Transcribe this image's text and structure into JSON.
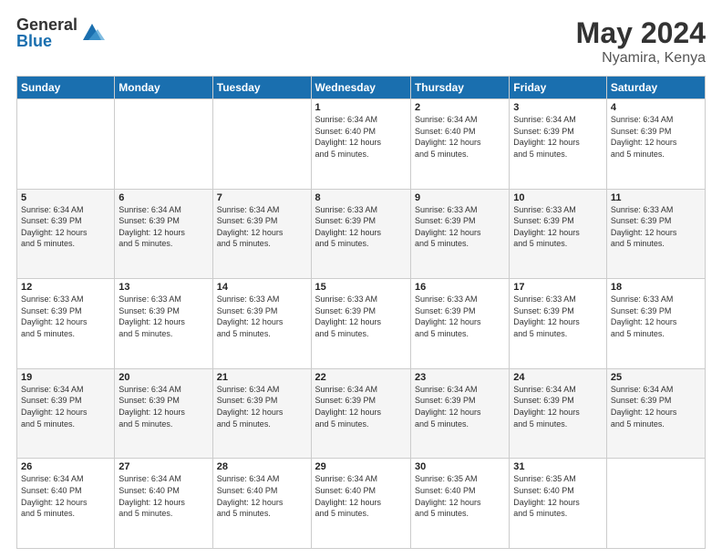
{
  "header": {
    "logo_general": "General",
    "logo_blue": "Blue",
    "month": "May 2024",
    "location": "Nyamira, Kenya"
  },
  "weekdays": [
    "Sunday",
    "Monday",
    "Tuesday",
    "Wednesday",
    "Thursday",
    "Friday",
    "Saturday"
  ],
  "rows": [
    [
      {
        "day": "",
        "info": ""
      },
      {
        "day": "",
        "info": ""
      },
      {
        "day": "",
        "info": ""
      },
      {
        "day": "1",
        "info": "Sunrise: 6:34 AM\nSunset: 6:40 PM\nDaylight: 12 hours\nand 5 minutes."
      },
      {
        "day": "2",
        "info": "Sunrise: 6:34 AM\nSunset: 6:40 PM\nDaylight: 12 hours\nand 5 minutes."
      },
      {
        "day": "3",
        "info": "Sunrise: 6:34 AM\nSunset: 6:39 PM\nDaylight: 12 hours\nand 5 minutes."
      },
      {
        "day": "4",
        "info": "Sunrise: 6:34 AM\nSunset: 6:39 PM\nDaylight: 12 hours\nand 5 minutes."
      }
    ],
    [
      {
        "day": "5",
        "info": "Sunrise: 6:34 AM\nSunset: 6:39 PM\nDaylight: 12 hours\nand 5 minutes."
      },
      {
        "day": "6",
        "info": "Sunrise: 6:34 AM\nSunset: 6:39 PM\nDaylight: 12 hours\nand 5 minutes."
      },
      {
        "day": "7",
        "info": "Sunrise: 6:34 AM\nSunset: 6:39 PM\nDaylight: 12 hours\nand 5 minutes."
      },
      {
        "day": "8",
        "info": "Sunrise: 6:33 AM\nSunset: 6:39 PM\nDaylight: 12 hours\nand 5 minutes."
      },
      {
        "day": "9",
        "info": "Sunrise: 6:33 AM\nSunset: 6:39 PM\nDaylight: 12 hours\nand 5 minutes."
      },
      {
        "day": "10",
        "info": "Sunrise: 6:33 AM\nSunset: 6:39 PM\nDaylight: 12 hours\nand 5 minutes."
      },
      {
        "day": "11",
        "info": "Sunrise: 6:33 AM\nSunset: 6:39 PM\nDaylight: 12 hours\nand 5 minutes."
      }
    ],
    [
      {
        "day": "12",
        "info": "Sunrise: 6:33 AM\nSunset: 6:39 PM\nDaylight: 12 hours\nand 5 minutes."
      },
      {
        "day": "13",
        "info": "Sunrise: 6:33 AM\nSunset: 6:39 PM\nDaylight: 12 hours\nand 5 minutes."
      },
      {
        "day": "14",
        "info": "Sunrise: 6:33 AM\nSunset: 6:39 PM\nDaylight: 12 hours\nand 5 minutes."
      },
      {
        "day": "15",
        "info": "Sunrise: 6:33 AM\nSunset: 6:39 PM\nDaylight: 12 hours\nand 5 minutes."
      },
      {
        "day": "16",
        "info": "Sunrise: 6:33 AM\nSunset: 6:39 PM\nDaylight: 12 hours\nand 5 minutes."
      },
      {
        "day": "17",
        "info": "Sunrise: 6:33 AM\nSunset: 6:39 PM\nDaylight: 12 hours\nand 5 minutes."
      },
      {
        "day": "18",
        "info": "Sunrise: 6:33 AM\nSunset: 6:39 PM\nDaylight: 12 hours\nand 5 minutes."
      }
    ],
    [
      {
        "day": "19",
        "info": "Sunrise: 6:34 AM\nSunset: 6:39 PM\nDaylight: 12 hours\nand 5 minutes."
      },
      {
        "day": "20",
        "info": "Sunrise: 6:34 AM\nSunset: 6:39 PM\nDaylight: 12 hours\nand 5 minutes."
      },
      {
        "day": "21",
        "info": "Sunrise: 6:34 AM\nSunset: 6:39 PM\nDaylight: 12 hours\nand 5 minutes."
      },
      {
        "day": "22",
        "info": "Sunrise: 6:34 AM\nSunset: 6:39 PM\nDaylight: 12 hours\nand 5 minutes."
      },
      {
        "day": "23",
        "info": "Sunrise: 6:34 AM\nSunset: 6:39 PM\nDaylight: 12 hours\nand 5 minutes."
      },
      {
        "day": "24",
        "info": "Sunrise: 6:34 AM\nSunset: 6:39 PM\nDaylight: 12 hours\nand 5 minutes."
      },
      {
        "day": "25",
        "info": "Sunrise: 6:34 AM\nSunset: 6:39 PM\nDaylight: 12 hours\nand 5 minutes."
      }
    ],
    [
      {
        "day": "26",
        "info": "Sunrise: 6:34 AM\nSunset: 6:40 PM\nDaylight: 12 hours\nand 5 minutes."
      },
      {
        "day": "27",
        "info": "Sunrise: 6:34 AM\nSunset: 6:40 PM\nDaylight: 12 hours\nand 5 minutes."
      },
      {
        "day": "28",
        "info": "Sunrise: 6:34 AM\nSunset: 6:40 PM\nDaylight: 12 hours\nand 5 minutes."
      },
      {
        "day": "29",
        "info": "Sunrise: 6:34 AM\nSunset: 6:40 PM\nDaylight: 12 hours\nand 5 minutes."
      },
      {
        "day": "30",
        "info": "Sunrise: 6:35 AM\nSunset: 6:40 PM\nDaylight: 12 hours\nand 5 minutes."
      },
      {
        "day": "31",
        "info": "Sunrise: 6:35 AM\nSunset: 6:40 PM\nDaylight: 12 hours\nand 5 minutes."
      },
      {
        "day": "",
        "info": ""
      }
    ]
  ]
}
